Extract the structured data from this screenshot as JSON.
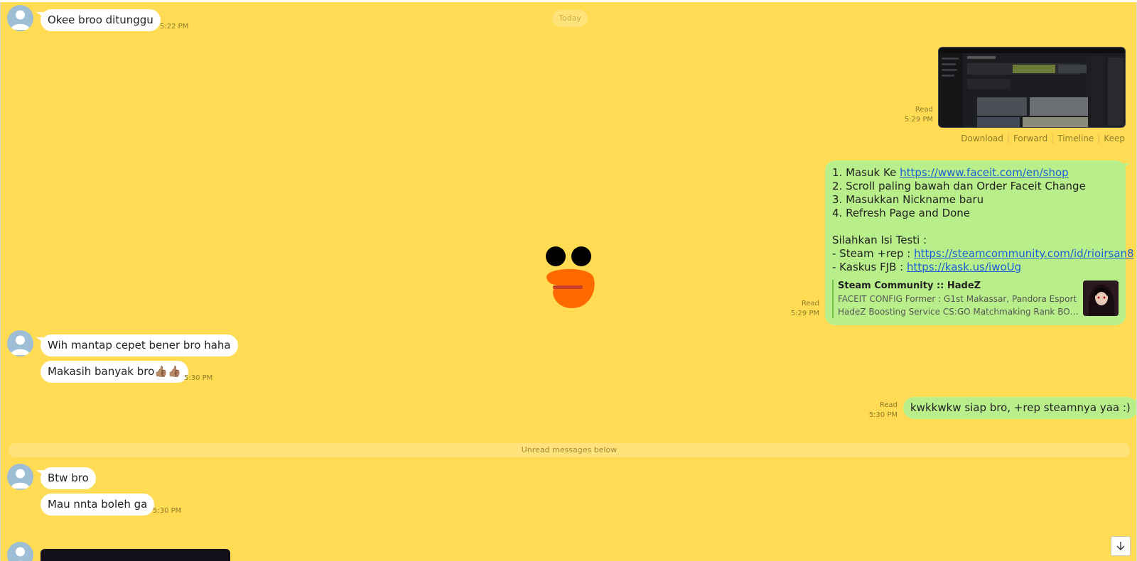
{
  "date_divider": "Today",
  "messages": {
    "m1": {
      "text": "Okee broo ditunggu",
      "time": "5:22 PM"
    },
    "m2": {
      "status": "Read",
      "time": "5:29 PM"
    },
    "image_actions": [
      "Download",
      "Forward",
      "Timeline",
      "Keep"
    ],
    "m3": {
      "lines": [
        {
          "prefix": "1. Masuk Ke ",
          "link": "https://www.faceit.com/en/shop"
        },
        {
          "prefix": "2. Scroll paling bawah dan Order Faceit Change",
          "link": ""
        },
        {
          "prefix": "3. Masukkan Nickname baru",
          "link": ""
        },
        {
          "prefix": "4. Refresh Page and Done",
          "link": ""
        },
        {
          "prefix": "",
          "link": ""
        },
        {
          "prefix": "Silahkan Isi Testi :",
          "link": ""
        },
        {
          "prefix": "- Steam +rep : ",
          "link": "https://steamcommunity.com/id/rioirsan8"
        },
        {
          "prefix": "- Kaskus FJB : ",
          "link": "https://kask.us/iwoUg"
        }
      ],
      "preview": {
        "title": "Steam Community :: HadeZ",
        "line1": "FACEIT CONFIG Former : G1st Makassar, Pandora Esport",
        "line2": "HadeZ Boosting Service CS:GO Matchmaking Rank BOOST (..."
      },
      "status": "Read",
      "time": "5:29 PM"
    },
    "m4": {
      "text": "Wih mantap cepet bener bro haha"
    },
    "m5": {
      "text": "Makasih banyak bro👍🏽👍🏽",
      "time": "5:30 PM"
    },
    "m6": {
      "text": "kwkkwkw siap bro, +rep steamnya yaa :)",
      "status": "Read",
      "time": "5:30 PM"
    },
    "unread_divider": "Unread messages below",
    "m7": {
      "text": "Btw bro"
    },
    "m8": {
      "text": "Mau nnta boleh ga",
      "time": "5:30 PM"
    }
  },
  "scroll_down_icon": "arrow-down-icon",
  "colors": {
    "background": "#ffdc53",
    "incoming_bubble": "#ffffff",
    "outgoing_bubble": "#b9ef8a",
    "link": "#1a5fd6"
  }
}
